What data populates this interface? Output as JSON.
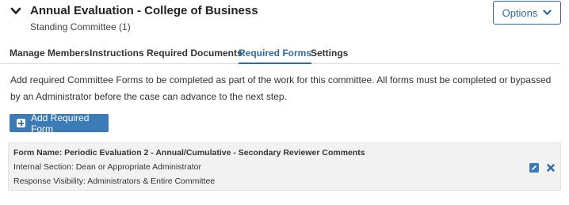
{
  "header": {
    "title": "Annual Evaluation - College of Business",
    "subtitle": "Standing Committee (1)",
    "collapse_icon": "chevron-down-icon",
    "options_label": "Options"
  },
  "tabs": [
    {
      "label": "Manage Members",
      "active": false
    },
    {
      "label": "Instructions",
      "active": false
    },
    {
      "label": "Required Documents",
      "active": false
    },
    {
      "label": "Required Forms",
      "active": true
    },
    {
      "label": "Settings",
      "active": false
    }
  ],
  "main": {
    "description": "Add required Committee Forms to be completed as part of the work for this committee. All forms must be completed or bypassed by an Administrator before the case can advance to the next step.",
    "add_button_label": "Add Required Form",
    "add_button_icon": "plus-square-icon"
  },
  "form_card": {
    "name_line": "Form Name: Periodic Evaluation 2 - Annual/Cumulative - Secondary Reviewer Comments",
    "section_line": "Internal Section: Dean or Appropriate Administrator",
    "visibility_line": "Response Visibility: Administrators & Entire Committee",
    "edit_icon": "edit-icon",
    "remove_icon": "close-icon"
  },
  "colors": {
    "accent": "#2d6aa3",
    "button_bg": "#3d7bb6",
    "card_bg": "#f2f2f2",
    "text": "#333333"
  }
}
